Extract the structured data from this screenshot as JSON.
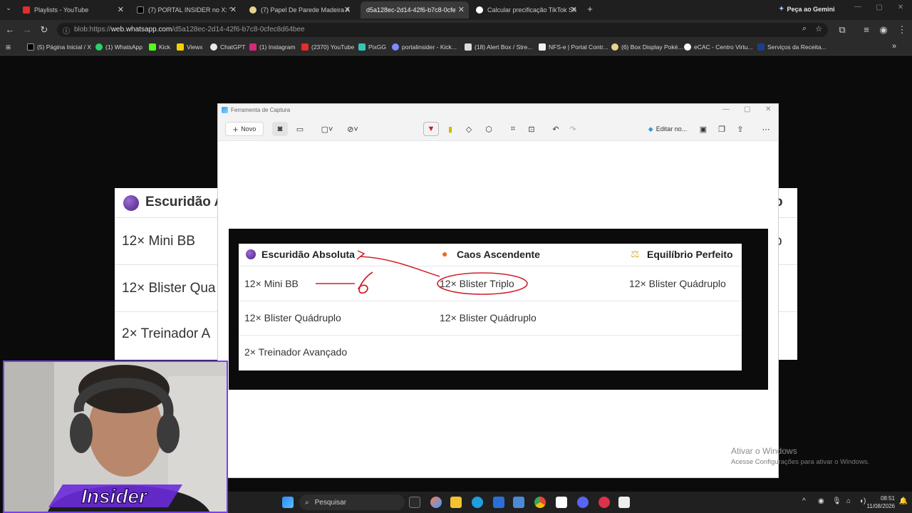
{
  "browser": {
    "tabs": [
      {
        "label": "Playlists - YouTube",
        "active": false
      },
      {
        "label": "(7) PORTAL INSIDER no X: \"",
        "active": false
      },
      {
        "label": "(7) Papel De Parede Madeira A",
        "active": false
      },
      {
        "label": "d5a128ec-2d14-42f6-b7c8-0cfe",
        "active": true
      },
      {
        "label": "Calcular precificação TikTok Sh",
        "active": false
      }
    ],
    "gemini_label": "Peça ao Gemini",
    "url_prefix": "blob:https://",
    "url_host": "web.whatsapp.com",
    "url_path": "/d5a128ec-2d14-42f6-b7c8-0cfec8d64bee",
    "bookmarks": [
      "(5) Página Inicial / X",
      "(1) WhatsApp",
      "Kick",
      "Viewx",
      "ChatGPT",
      "(1) Instagram",
      "(2370) YouTube",
      "PixGG",
      "portalinsider - Kick...",
      "(18) Alert Box / Stre...",
      "NFS-e | Portal Contr...",
      "(6) Box Display Poké...",
      "eCAC - Centro Virtu...",
      "Serviços da Receita..."
    ]
  },
  "background_doc": {
    "header": "Escuridão A",
    "header_right": "o",
    "rows": [
      "12× Mini BB",
      "12× Blister Qua",
      "2× Treinador A"
    ],
    "row1_right": "o"
  },
  "snipping_tool": {
    "title": "Ferramenta de Captura",
    "new_label": "Novo",
    "edit_label": "Editar no..."
  },
  "capture_table": {
    "headers": [
      "Escuridão Absoluta",
      "Caos Ascendente",
      "Equilíbrio Perfeito"
    ],
    "header_icons": [
      "purple-orb-icon",
      "fire-icon",
      "balance-icon"
    ],
    "rows": [
      [
        "12× Mini BB",
        "12× Blister Triplo",
        "12× Blister Quádruplo"
      ],
      [
        "12× Blister Quádruplo",
        "12× Blister Quádruplo",
        ""
      ],
      [
        "2× Treinador Avançado",
        "",
        ""
      ]
    ],
    "annotation": "6",
    "colors": {
      "ink": "#d0212c",
      "orb": "#6a3aa8",
      "fire": "#e86a1c"
    }
  },
  "overlay": {
    "logo_text": "Insider"
  },
  "watermark": {
    "line1": "Ativar o Windows",
    "line2": "Acesse Configurações para ativar o Windows."
  },
  "taskbar": {
    "search_placeholder": "Pesquisar",
    "time": "08:51",
    "date": "11/08/2026"
  }
}
